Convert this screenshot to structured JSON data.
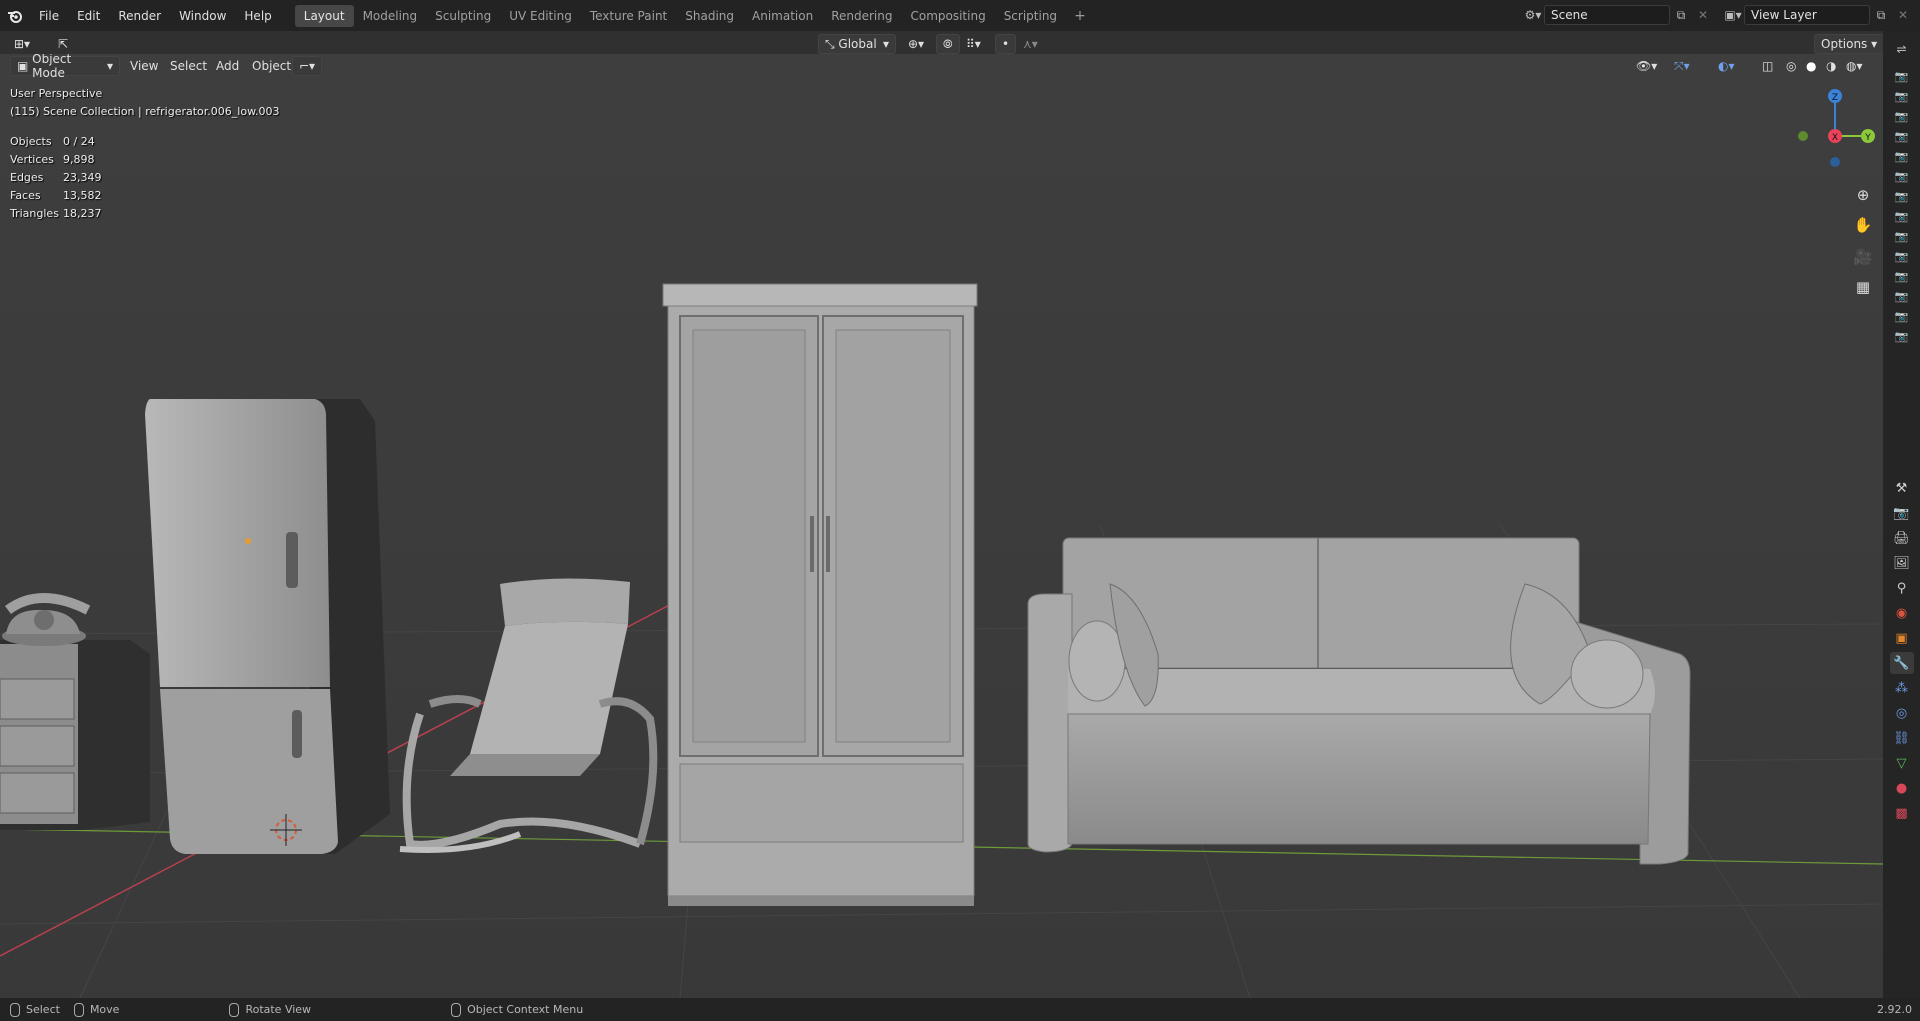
{
  "app": {
    "menu": [
      "File",
      "Edit",
      "Render",
      "Window",
      "Help"
    ],
    "workspaces": [
      "Layout",
      "Modeling",
      "Sculpting",
      "UV Editing",
      "Texture Paint",
      "Shading",
      "Animation",
      "Rendering",
      "Compositing",
      "Scripting"
    ],
    "active_workspace": "Layout",
    "add_workspace": "+",
    "scene_name": "Scene",
    "view_layer_name": "View Layer",
    "version": "2.92.0"
  },
  "tool_header": {
    "transform_orientation": "Global",
    "options_label": "Options"
  },
  "viewport_header": {
    "mode": "Object Mode",
    "menus": [
      "View",
      "Select",
      "Add",
      "Object"
    ]
  },
  "viewport": {
    "perspective": "User Perspective",
    "collection_info": "(115) Scene Collection | refrigerator.006_low.003",
    "stats": [
      {
        "label": "Objects",
        "value": "0 / 24"
      },
      {
        "label": "Vertices",
        "value": "9,898"
      },
      {
        "label": "Edges",
        "value": "23,349"
      },
      {
        "label": "Faces",
        "value": "13,582"
      },
      {
        "label": "Triangles",
        "value": "18,237"
      }
    ],
    "gizmo": {
      "z": "Z",
      "y": "Y",
      "x": "X"
    }
  },
  "statusbar": {
    "select": "Select",
    "move": "Move",
    "rotate": "Rotate View",
    "context": "Object Context Menu"
  },
  "colors": {
    "axis_x": "#e8435a",
    "axis_y": "#8bc83a",
    "axis_z": "#3a83d9",
    "active_prop": "#3b74c4"
  }
}
